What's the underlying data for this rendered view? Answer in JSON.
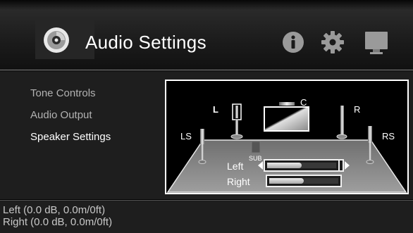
{
  "header": {
    "title": "Audio Settings",
    "icons": [
      "speaker-disc-icon",
      "info-icon",
      "gear-icon",
      "monitor-icon"
    ]
  },
  "menu": {
    "items": [
      {
        "label": "Tone Controls",
        "active": false
      },
      {
        "label": "Audio Output",
        "active": false
      },
      {
        "label": "Speaker Settings",
        "active": true
      }
    ]
  },
  "speaker_diagram": {
    "speakers": {
      "left": "L",
      "center": "C",
      "right": "R",
      "left_surround": "LS",
      "right_surround": "RS",
      "subwoofer": "SUB"
    },
    "level_rows": [
      {
        "label": "Left",
        "level": 0.5,
        "selected": true
      },
      {
        "label": "Right",
        "level": 0.5,
        "selected": false
      }
    ]
  },
  "status": {
    "line1": "Left (0.0 dB, 0.0m/0ft)",
    "line2": "Right (0.0 dB, 0.0m/0ft)"
  },
  "colors": {
    "background": "#1e1e1e",
    "highlight_text": "#ffffff",
    "dim_text": "#b2b2b2"
  }
}
